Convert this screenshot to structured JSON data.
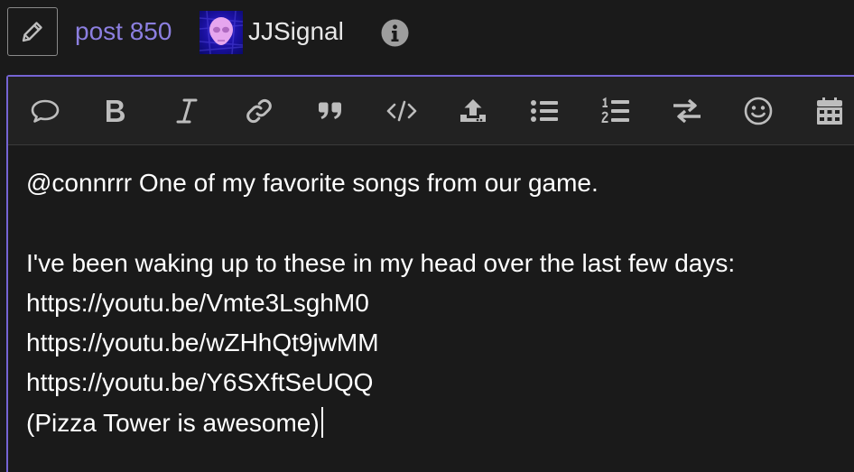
{
  "header": {
    "edit_icon": "pencil-icon",
    "post_label": "post 850",
    "username": "JJSignal",
    "info_icon": "info-circle-icon",
    "accent_color": "#8c7fe0"
  },
  "toolbar": {
    "buttons": [
      {
        "name": "quote-bubble-icon"
      },
      {
        "name": "bold-icon"
      },
      {
        "name": "italic-icon"
      },
      {
        "name": "link-icon"
      },
      {
        "name": "blockquote-icon"
      },
      {
        "name": "code-icon"
      },
      {
        "name": "upload-icon"
      },
      {
        "name": "bullet-list-icon"
      },
      {
        "name": "numbered-list-icon"
      },
      {
        "name": "toggle-direction-icon"
      },
      {
        "name": "emoji-icon"
      },
      {
        "name": "calendar-icon"
      }
    ]
  },
  "composer": {
    "border_color": "#7564d4",
    "lines": [
      "@connrrr One of my favorite songs from our game.",
      "",
      "I've been waking up to these in my head over the last few days:",
      "https://youtu.be/Vmte3LsghM0",
      "https://youtu.be/wZHhQt9jwMM",
      "https://youtu.be/Y6SXftSeUQQ",
      "(Pizza Tower is awesome)"
    ]
  }
}
